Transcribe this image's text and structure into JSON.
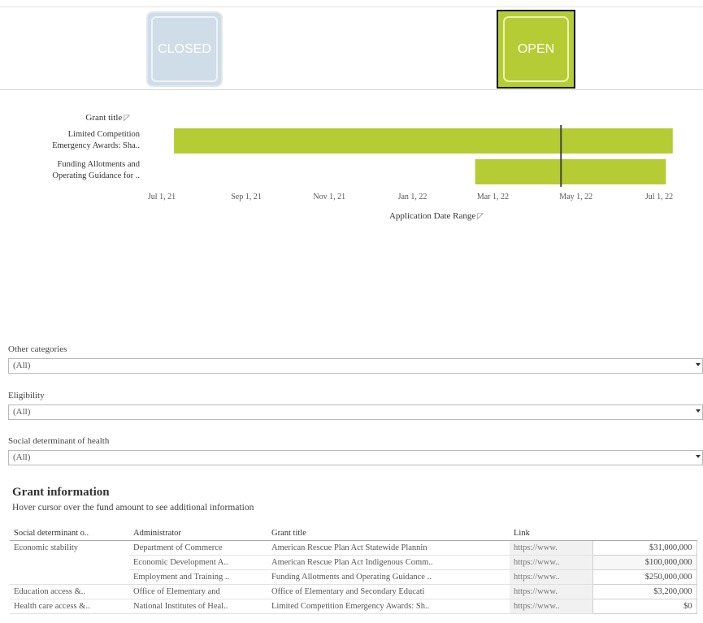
{
  "toggle": {
    "closed_label": "CLOSED",
    "open_label": "OPEN",
    "selected": "OPEN",
    "closed_color": "#cfdde8",
    "open_color": "#b5cc34"
  },
  "chart_data": {
    "type": "bar",
    "orientation": "horizontal-gantt",
    "y_header": "Grant title",
    "categories": [
      "Limited Competition Emergency Awards: Sha..",
      "Funding Allotments and Operating Guidance for .."
    ],
    "category_lines": [
      [
        "Limited Competition",
        "Emergency Awards: Sha.."
      ],
      [
        "Funding Allotments and",
        "Operating Guidance for .."
      ]
    ],
    "ranges": [
      {
        "start": "2021-07-10",
        "end": "2022-07-11"
      },
      {
        "start": "2022-02-16",
        "end": "2022-07-06"
      }
    ],
    "reference_line": "2022-04-20",
    "x_ticks": [
      "Jul 1, 21",
      "Sep 1, 21",
      "Nov 1, 21",
      "Jan 1, 22",
      "Mar 1, 22",
      "May 1, 22",
      "Jul 1, 22"
    ],
    "x_tick_dates": [
      "2021-07-01",
      "2021-09-01",
      "2021-11-01",
      "2022-01-01",
      "2022-03-01",
      "2022-05-01",
      "2022-07-01"
    ],
    "xlabel": "Application Date Range",
    "bar_color": "#b5cc34",
    "reference_color": "#444444"
  },
  "filters": [
    {
      "label": "Other categories",
      "value": "(All)"
    },
    {
      "label": "Eligibility",
      "value": "(All)"
    },
    {
      "label": "Social determinant of health",
      "value": "(All)"
    }
  ],
  "grant_info": {
    "title": "Grant information",
    "subtitle": "Hover cursor over the fund amount to see additional information",
    "columns": [
      "Social determinant o..",
      "Administrator",
      "Grant title",
      "Link",
      ""
    ],
    "rows": [
      {
        "category": "Economic stability",
        "administrator": "Department of Commerce",
        "grant_title": "American Rescue Plan Act Statewide Plannin",
        "link": "https://www.",
        "amount": "$31,000,000"
      },
      {
        "category": "",
        "administrator": "Economic Development A..",
        "grant_title": "American Rescue Plan Act Indigenous Comm..",
        "link": "https://www..",
        "amount": "$100,000,000"
      },
      {
        "category": "",
        "administrator": "Employment and Training ..",
        "grant_title": "Funding Allotments and Operating Guidance ..",
        "link": "https://www..",
        "amount": "$250,000,000"
      },
      {
        "category": "Education access &..",
        "administrator": "Office of Elementary and",
        "grant_title": "Office of Elementary and Secondary Educati",
        "link": "https://www.",
        "amount": "$3,200,000"
      },
      {
        "category": "Health care access &..",
        "administrator": "National Institutes of Heal..",
        "grant_title": "Limited Competition Emergency Awards: Sh..",
        "link": "https://www..",
        "amount": "$0"
      }
    ]
  }
}
